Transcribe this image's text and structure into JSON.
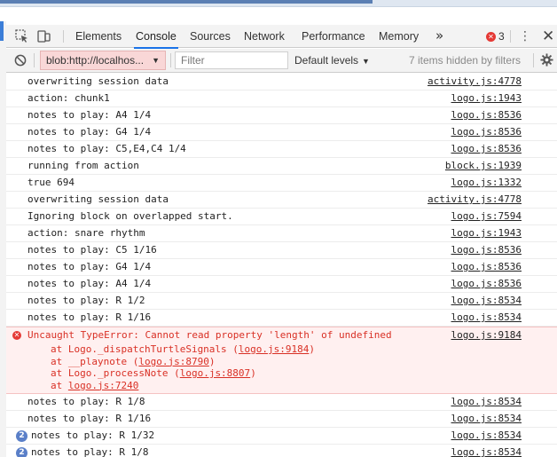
{
  "tabs": {
    "items": [
      {
        "label": "Elements"
      },
      {
        "label": "Console"
      },
      {
        "label": "Sources"
      },
      {
        "label": "Network"
      },
      {
        "label": "Performance"
      },
      {
        "label": "Memory"
      }
    ],
    "more": "»",
    "error_count": "3",
    "kebab": "⋮",
    "close": "✕"
  },
  "toolbar": {
    "context": "blob:http://localhos...",
    "context_caret": "▼",
    "filter_placeholder": "Filter",
    "levels": "Default levels",
    "levels_caret": "▼",
    "hidden": "7 items hidden by filters"
  },
  "logs": [
    {
      "msg": "overwriting session data",
      "src": "activity.js:4778"
    },
    {
      "msg": "action: chunk1",
      "src": "logo.js:1943"
    },
    {
      "msg": "notes to play: A4 1/4",
      "src": "logo.js:8536"
    },
    {
      "msg": "notes to play: G4 1/4",
      "src": "logo.js:8536"
    },
    {
      "msg": "notes to play: C5,E4,C4 1/4",
      "src": "logo.js:8536"
    },
    {
      "msg": "running from action",
      "src": "block.js:1939"
    },
    {
      "msg": "true 694",
      "src": "logo.js:1332"
    },
    {
      "msg": "overwriting session data",
      "src": "activity.js:4778"
    },
    {
      "msg": "Ignoring block on overlapped start.",
      "src": "logo.js:7594"
    },
    {
      "msg": "action: snare rhythm",
      "src": "logo.js:1943"
    },
    {
      "msg": "notes to play: C5 1/16",
      "src": "logo.js:8536"
    },
    {
      "msg": "notes to play: G4 1/4",
      "src": "logo.js:8536"
    },
    {
      "msg": "notes to play: A4 1/4",
      "src": "logo.js:8536"
    },
    {
      "msg": "notes to play: R 1/2",
      "src": "logo.js:8534"
    },
    {
      "msg": "notes to play: R 1/16",
      "src": "logo.js:8534"
    }
  ],
  "error": {
    "icon": "✕",
    "msg": "Uncaught TypeError: Cannot read property 'length' of undefined",
    "src": "logo.js:9184",
    "stack": [
      {
        "pre": "at Logo._dispatchTurtleSignals (",
        "link": "logo.js:9184",
        "post": ")"
      },
      {
        "pre": "at __playnote (",
        "link": "logo.js:8790",
        "post": ")"
      },
      {
        "pre": "at Logo._processNote (",
        "link": "logo.js:8807",
        "post": ")"
      },
      {
        "pre": "at ",
        "link": "logo.js:7240",
        "post": ""
      }
    ]
  },
  "logs_after": [
    {
      "msg": "notes to play: R 1/8",
      "src": "logo.js:8534"
    },
    {
      "msg": "notes to play: R 1/16",
      "src": "logo.js:8534"
    },
    {
      "msg": "notes to play: R 1/32",
      "src": "logo.js:8534",
      "count": "2"
    },
    {
      "msg": "notes to play: R 1/8",
      "src": "logo.js:8534",
      "count": "2"
    }
  ],
  "colors": {
    "accent": "#1a73e8",
    "error": "#d93025",
    "context_bg": "#f9d7d7"
  }
}
